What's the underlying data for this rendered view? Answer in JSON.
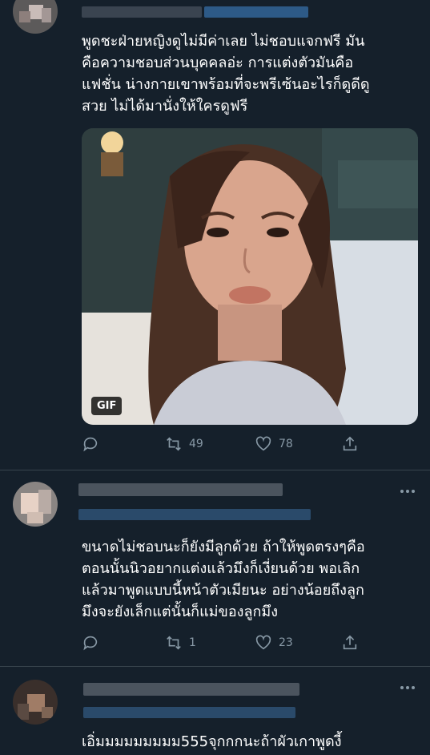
{
  "tweets": [
    {
      "text": "พูดชะฝ่ายหญิงดูไม่มีค่าเลย ไม่ชอบแจกฟรี มัน\nคือความชอบส่วนบุคคลอ่ะ การแต่งตัวมันคือ\nแฟชั่น น่างกายเขาพร้อมที่จะพรีเซ้นอะไรก็ดูดีดู\nสวย ไม่ได้มานั่งให้ใครดูฟรี",
      "media_badge": "GIF",
      "retweets": "49",
      "likes": "78"
    },
    {
      "text": "ขนาดไม่ชอบนะก็ยังมีลูกด้วย ถ้าให้พูดตรงๆคือ\nตอนนั้นนิวอยากแต่งแล้วมึงก็เงี่ยนด้วย พอเลิก\nแล้วมาพูดแบบนี้หน้าตัวเมียนะ อย่างน้อยถึงลูก\nมึงจะยังเล็กแต่นั้นก็แม่ของลูกมึง",
      "retweets": "1",
      "likes": "23"
    },
    {
      "text": "เอิ่มมมมมมมมม555จุกกกนะถ้าผัวเกาพูดงี้"
    }
  ],
  "colors": {
    "background": "#15202b",
    "divider": "#38444d",
    "icon_gray": "#8899a6",
    "text": "#ffffff"
  },
  "icons": [
    "reply-icon",
    "retweet-icon",
    "like-icon",
    "share-icon",
    "more-icon"
  ]
}
